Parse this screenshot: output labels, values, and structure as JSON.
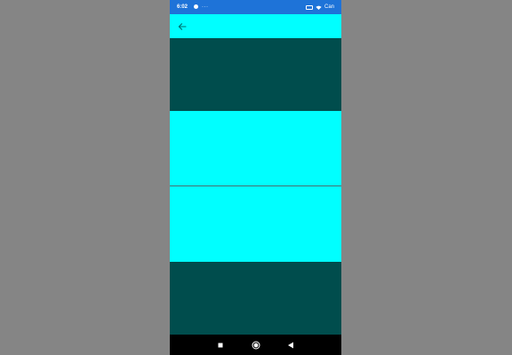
{
  "status_bar": {
    "time": "6:02",
    "overflow": "···",
    "carrier": "Can"
  },
  "toolbar": {
    "back_icon": "arrow-left-icon"
  },
  "colors": {
    "outer_background": "#858585",
    "status_bar": "#1e73d8",
    "toolbar": "#00ffff",
    "dark_band": "#004d4d",
    "light_band": "#00ffff",
    "nav_bar": "#000000"
  },
  "nav_bar": {
    "recents_icon": "square-icon",
    "home_icon": "circle-icon",
    "back_icon": "triangle-back-icon"
  }
}
